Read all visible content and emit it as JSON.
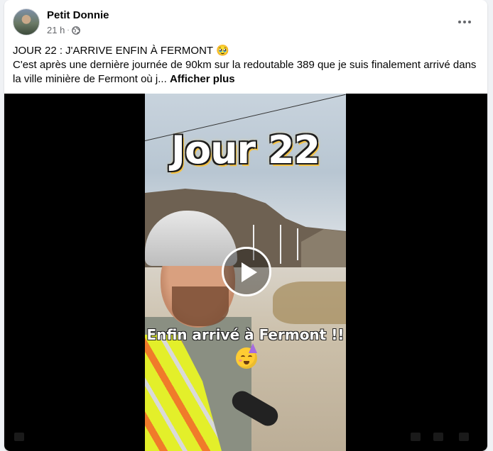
{
  "post": {
    "author": "Petit Donnie",
    "timestamp": "21 h",
    "separator": "·",
    "privacy_icon": "globe-icon",
    "title_line": "JOUR 22 : J'ARRIVE ENFIN À FERMONT 🥹",
    "body_text": "C'est après une dernière journée de 90km sur la redoutable 389 que je suis finalement arrivé dans la ville minière de Fermont où j...",
    "see_more_label": "Afficher plus",
    "more_icon": "more-horizontal-icon"
  },
  "video": {
    "overlay_title": "Jour 22",
    "overlay_caption": "Enfin arrivé à Fermont !!",
    "caption_emoji": "partying-face-emoji",
    "play_icon": "play-icon"
  },
  "colors": {
    "card_bg": "#ffffff",
    "page_bg": "#f0f2f5",
    "secondary_text": "#65676b",
    "title_glow": "#f5c242"
  }
}
